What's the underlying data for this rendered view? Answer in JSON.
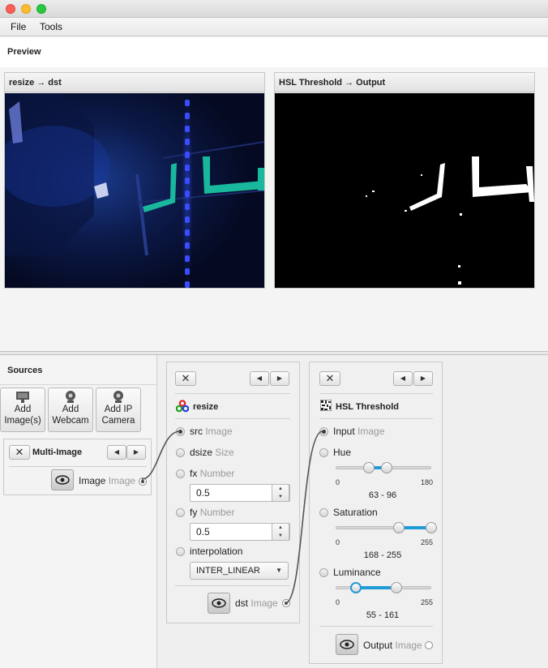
{
  "menu": {
    "file": "File",
    "tools": "Tools"
  },
  "preview": {
    "title": "Preview",
    "panels": [
      {
        "title": "resize → dst"
      },
      {
        "title": "HSL Threshold → Output"
      }
    ]
  },
  "sources": {
    "title": "Sources",
    "buttons": [
      {
        "line1": "Add",
        "line2": "Image(s)"
      },
      {
        "line1": "Add",
        "line2": "Webcam"
      },
      {
        "line1": "Add IP",
        "line2": "Camera"
      }
    ],
    "multi_image": {
      "close": "✕",
      "title": "Multi-Image",
      "output_label": "Image",
      "output_type": "Image"
    }
  },
  "resize_step": {
    "close": "✕",
    "title": "resize",
    "src": {
      "label": "src",
      "type": "Image"
    },
    "dsize": {
      "label": "dsize",
      "type": "Size"
    },
    "fx": {
      "label": "fx",
      "type": "Number",
      "value": "0.5"
    },
    "fy": {
      "label": "fy",
      "type": "Number",
      "value": "0.5"
    },
    "interpolation": {
      "label": "interpolation",
      "value": "INTER_LINEAR"
    },
    "dst": {
      "label": "dst",
      "type": "Image"
    }
  },
  "hsl_step": {
    "close": "✕",
    "title": "HSL Threshold",
    "input": {
      "label": "Input",
      "type": "Image"
    },
    "hue": {
      "label": "Hue",
      "min": "0",
      "max": "180",
      "range_text": "63 - 96",
      "low": 63,
      "high": 96,
      "scale_max": 180
    },
    "saturation": {
      "label": "Saturation",
      "min": "0",
      "max": "255",
      "range_text": "168 - 255",
      "low": 168,
      "high": 255,
      "scale_max": 255
    },
    "luminance": {
      "label": "Luminance",
      "min": "0",
      "max": "255",
      "range_text": "55 - 161",
      "low": 55,
      "high": 161,
      "scale_max": 255
    },
    "output": {
      "label": "Output",
      "type": "Image"
    }
  },
  "colors": {
    "accent": "#1f9bd6",
    "teal": "#19b89c",
    "blue_glow": "#2b3cff"
  }
}
